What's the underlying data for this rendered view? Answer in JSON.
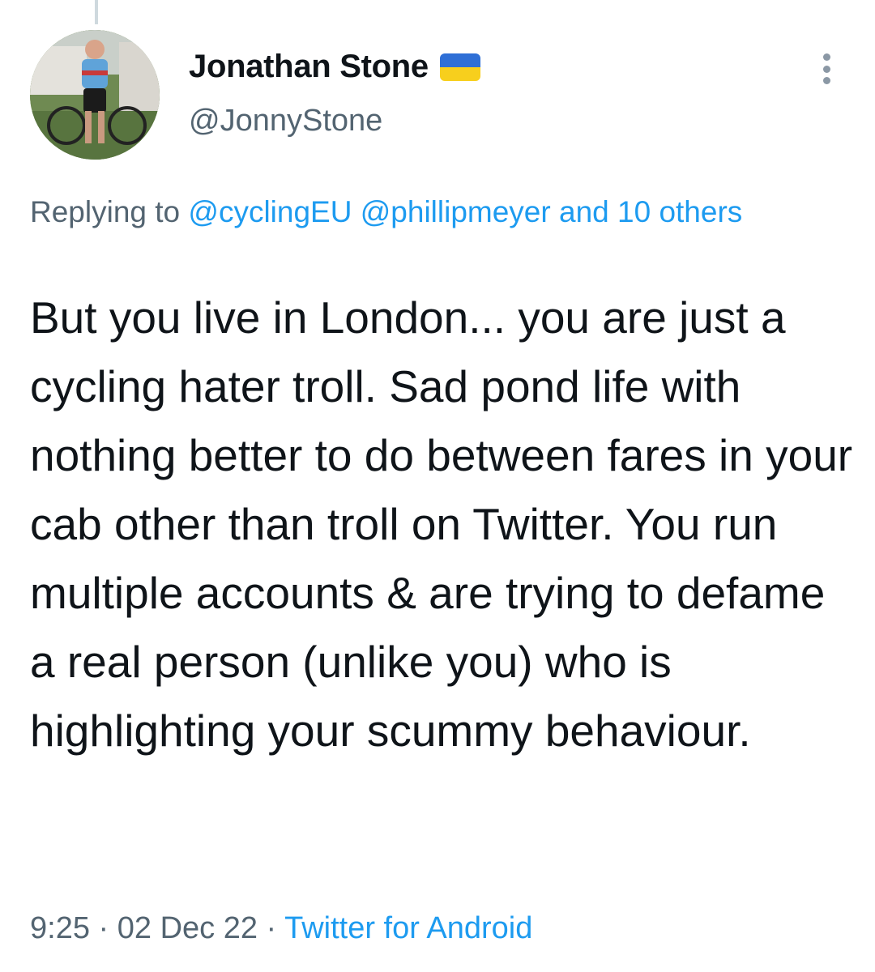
{
  "tweet": {
    "author": {
      "display_name": "Jonathan Stone",
      "handle": "@JonnyStone",
      "flag_icon": "ukraine-flag-icon",
      "flag_colors": [
        "#2f6fd6",
        "#f7cf1d"
      ]
    },
    "more_icon": "more-vertical-icon",
    "reply": {
      "prefix": "Replying to ",
      "mention_1": "@cyclingEU",
      "mention_2": "@phillipmeyer",
      "others": "and 10 others"
    },
    "text": "But you live in London... you are just a cycling hater troll. Sad pond life with nothing better to do between fares in your cab other than troll on Twitter. You run multiple accounts & are trying to defame a real person (unlike you) who is highlighting your scummy behaviour.",
    "meta": {
      "time": "9:25",
      "separator": " · ",
      "date": "02 Dec 22",
      "source": "Twitter for Android"
    }
  },
  "colors": {
    "link": "#1d9bf0",
    "secondary_text": "#536471",
    "primary_text": "#0f1419"
  }
}
